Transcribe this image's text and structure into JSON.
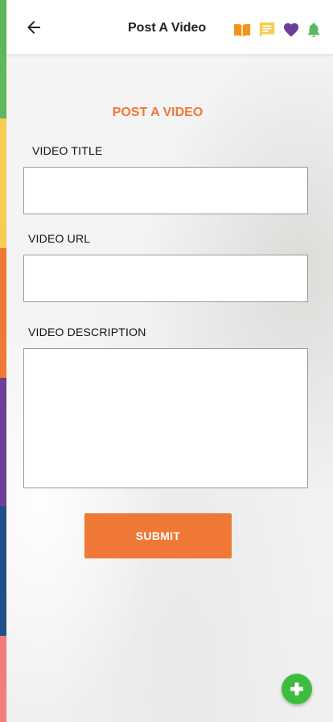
{
  "header": {
    "title": "Post A Video",
    "icons": [
      "back-arrow-icon",
      "book-icon",
      "chat-icon",
      "heart-icon",
      "bell-icon"
    ]
  },
  "colors": {
    "accent": "#f07836",
    "book": "#f4931e",
    "chat": "#f8cb52",
    "heart": "#6a3f96",
    "bell": "#5cb85c",
    "fab": "#3dbd3d",
    "stripes": [
      "#5cb85c",
      "#f8cb52",
      "#f07836",
      "#6a3f96",
      "#1e4f8a",
      "#f47c7c"
    ]
  },
  "form": {
    "heading": "POST A VIDEO",
    "title_label": "VIDEO TITLE",
    "title_value": "",
    "url_label": "VIDEO URL",
    "url_value": "",
    "description_label": "VIDEO DESCRIPTION",
    "description_value": "",
    "submit_label": "SUBMIT"
  },
  "fab": {
    "icon": "plus-icon"
  }
}
